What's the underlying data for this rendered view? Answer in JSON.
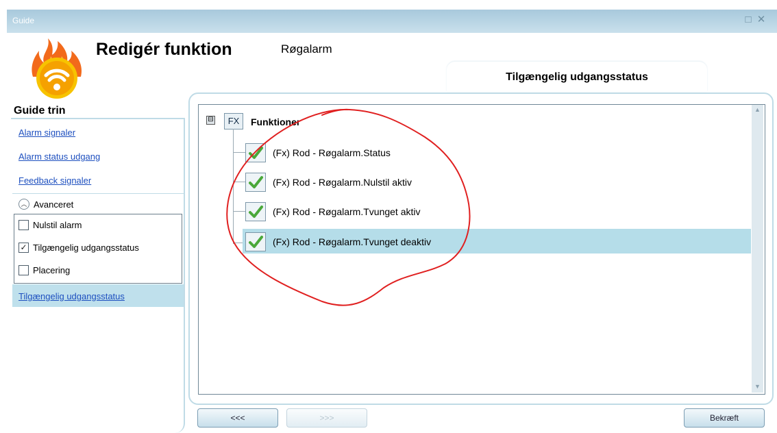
{
  "window": {
    "title": "Guide"
  },
  "header": {
    "title": "Redigér funktion",
    "subtitle": "Røgalarm"
  },
  "tab": {
    "label": "Tilgængelig udgangsstatus"
  },
  "sidebar": {
    "title": "Guide trin",
    "links": [
      {
        "label": "Alarm signaler"
      },
      {
        "label": "Alarm status udgang"
      },
      {
        "label": "Feedback signaler"
      }
    ],
    "advanced": {
      "label": "Avanceret",
      "options": [
        {
          "label": "Nulstil alarm",
          "checked": false
        },
        {
          "label": "Tilgængelig udgangsstatus",
          "checked": true
        },
        {
          "label": "Placering",
          "checked": false
        }
      ]
    },
    "selected_link": {
      "label": "Tilgængelig udgangsstatus"
    }
  },
  "tree": {
    "root": {
      "icon": "FX",
      "label": "Funktioner",
      "expander": "⊟"
    },
    "items": [
      {
        "label": "(Fx) Rod - Røgalarm.Status",
        "checked": true
      },
      {
        "label": "(Fx) Rod - Røgalarm.Nulstil aktiv",
        "checked": true
      },
      {
        "label": "(Fx) Rod - Røgalarm.Tvunget aktiv",
        "checked": true
      },
      {
        "label": "(Fx) Rod - Røgalarm.Tvunget deaktiv",
        "checked": true,
        "selected": true
      }
    ]
  },
  "buttons": {
    "prev": "<<<",
    "next": ">>>",
    "confirm": "Bekræft"
  },
  "colors": {
    "accent": "#bfdbe6",
    "selection": "#b5dde9",
    "link": "#1d4fbf",
    "annotation": "#e02020"
  }
}
